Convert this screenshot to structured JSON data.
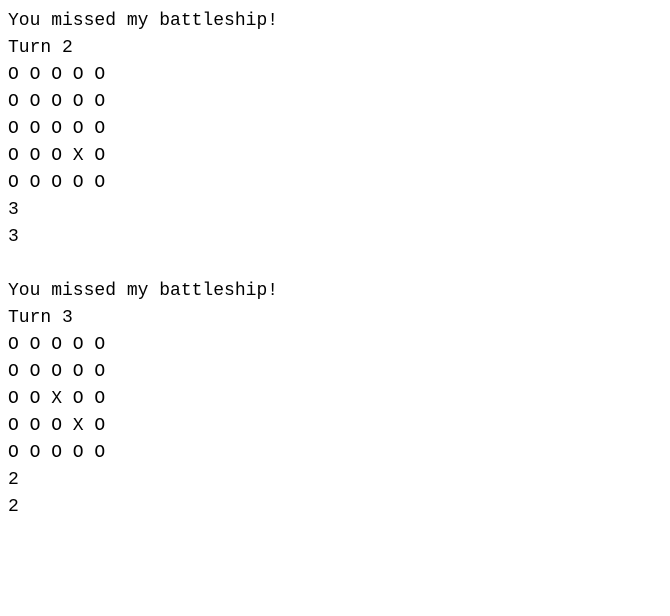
{
  "game": {
    "blocks": [
      {
        "miss_message": "You missed my battleship!",
        "turn_label": "Turn 2",
        "grid": [
          "O O O O O",
          "O O O O O",
          "O O O O O",
          "O O O X O",
          "O O O O O"
        ],
        "coord1": "3",
        "coord2": "3"
      },
      {
        "miss_message": "You missed my battleship!",
        "turn_label": "Turn 3",
        "grid": [
          "O O O O O",
          "O O O O O",
          "O O X O O",
          "O O O X O",
          "O O O O O"
        ],
        "coord1": "2",
        "coord2": "2"
      }
    ]
  }
}
